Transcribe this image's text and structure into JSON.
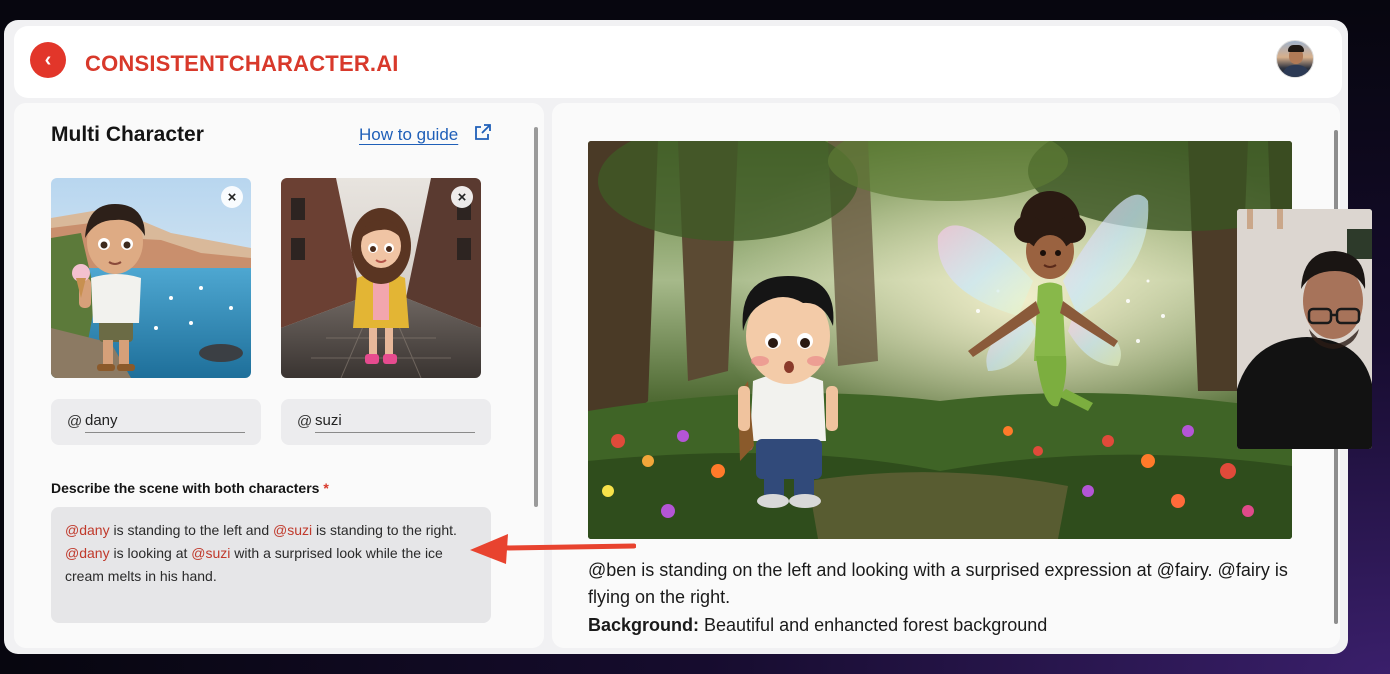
{
  "app": {
    "brand": "CONSISTENTCHARACTER.AI",
    "back_label": "‹",
    "back_icon": "chevron-left-icon",
    "accent_color": "#e2362a"
  },
  "multi": {
    "title": "Multi Character",
    "guide_link": "How to guide",
    "guide_icon": "external-link-icon",
    "characters": [
      {
        "tag": "dany",
        "remove_label": "×"
      },
      {
        "tag": "suzi",
        "remove_label": "×"
      }
    ],
    "at_symbol": "@",
    "scene_label": "Describe the scene with both characters",
    "required_mark": "*",
    "scene_text": {
      "m1": "@dany",
      "t1": " is standing to the left and ",
      "m2": "@suzi",
      "t2": " is standing to the right. ",
      "m3": "@dany",
      "t3": " is looking at ",
      "m4": "@suzi",
      "t4": " with a surprised look while the ice cream melts in his hand."
    }
  },
  "output": {
    "description": "@ben is standing on the left and looking with a surprised expression at @fairy. @fairy is flying on the right.",
    "background_label": "Background:",
    "background_value": " Beautiful and enhancted forest background"
  }
}
